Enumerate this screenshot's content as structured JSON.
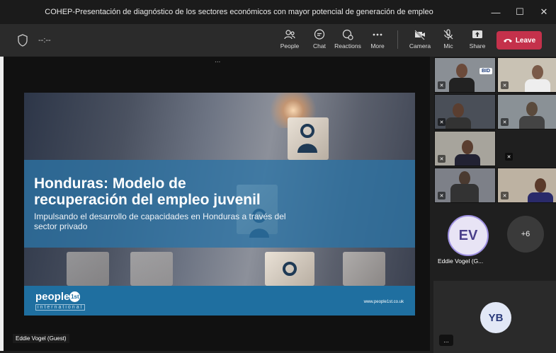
{
  "window": {
    "title": "COHEP-Presentación de diagnóstico de los sectores económicos con mayor potencial de generación de empleo"
  },
  "toolbar": {
    "timer": "--:--",
    "people_label": "People",
    "chat_label": "Chat",
    "reactions_label": "Reactions",
    "more_label": "More",
    "camera_label": "Camera",
    "mic_label": "Mic",
    "share_label": "Share",
    "leave_label": "Leave"
  },
  "slide": {
    "title_line1": "Honduras: Modelo de",
    "title_line2": "recuperación del empleo juvenil",
    "subtitle": "Impulsando el desarrollo de capacidades en Honduras a través del sector privado",
    "logo_main": "people",
    "logo_badge": "1st",
    "logo_sub": "international",
    "url": "www.people1st.co.uk"
  },
  "stage": {
    "presenter_name": "Eddie Vogel (Guest)",
    "dots": "..."
  },
  "participants": {
    "ev_initials": "EV",
    "ev_name": "Eddie Vogel (G...",
    "more_count": "+6",
    "yb_initials": "YB",
    "tile_logo": "BID",
    "more_options": "..."
  },
  "colors": {
    "leave": "#c4314b",
    "band": "#2c73a5",
    "footer": "#1f6fa0"
  }
}
